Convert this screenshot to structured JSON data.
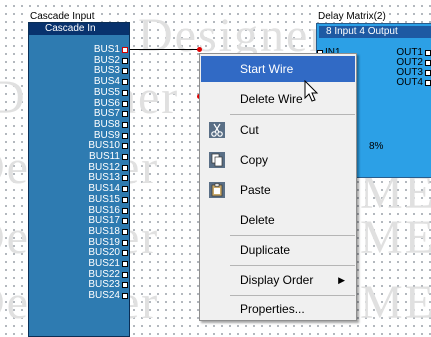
{
  "watermark": {
    "text": "Designer",
    "partial": "ME"
  },
  "cascade": {
    "title": "Cascade Input",
    "header": "Cascade In",
    "buses": [
      "BUS1",
      "BUS2",
      "BUS3",
      "BUS4",
      "BUS5",
      "BUS6",
      "BUS7",
      "BUS8",
      "BUS9",
      "BUS10",
      "BUS11",
      "BUS12",
      "BUS13",
      "BUS14",
      "BUS15",
      "BUS16",
      "BUS17",
      "BUS18",
      "BUS19",
      "BUS20",
      "BUS21",
      "BUS22",
      "BUS23",
      "BUS24"
    ]
  },
  "delay": {
    "title": "Delay Matrix(2)",
    "header": "8 Input 4 Output",
    "input": "IN1",
    "outputs": [
      "OUT1",
      "OUT2",
      "OUT3",
      "OUT4"
    ],
    "level": "8%"
  },
  "menu": {
    "start_wire": "Start Wire",
    "delete_wire": "Delete Wire",
    "cut": "Cut",
    "copy": "Copy",
    "paste": "Paste",
    "delete": "Delete",
    "duplicate": "Duplicate",
    "display_order": "Display Order",
    "properties": "Properties..."
  },
  "colors": {
    "cascade_block": "#2e7bb1",
    "cascade_header": "#08326d",
    "delay_block": "#2ca0e6",
    "menu_highlight": "#316ac5",
    "wire_marker": "#e00000"
  }
}
